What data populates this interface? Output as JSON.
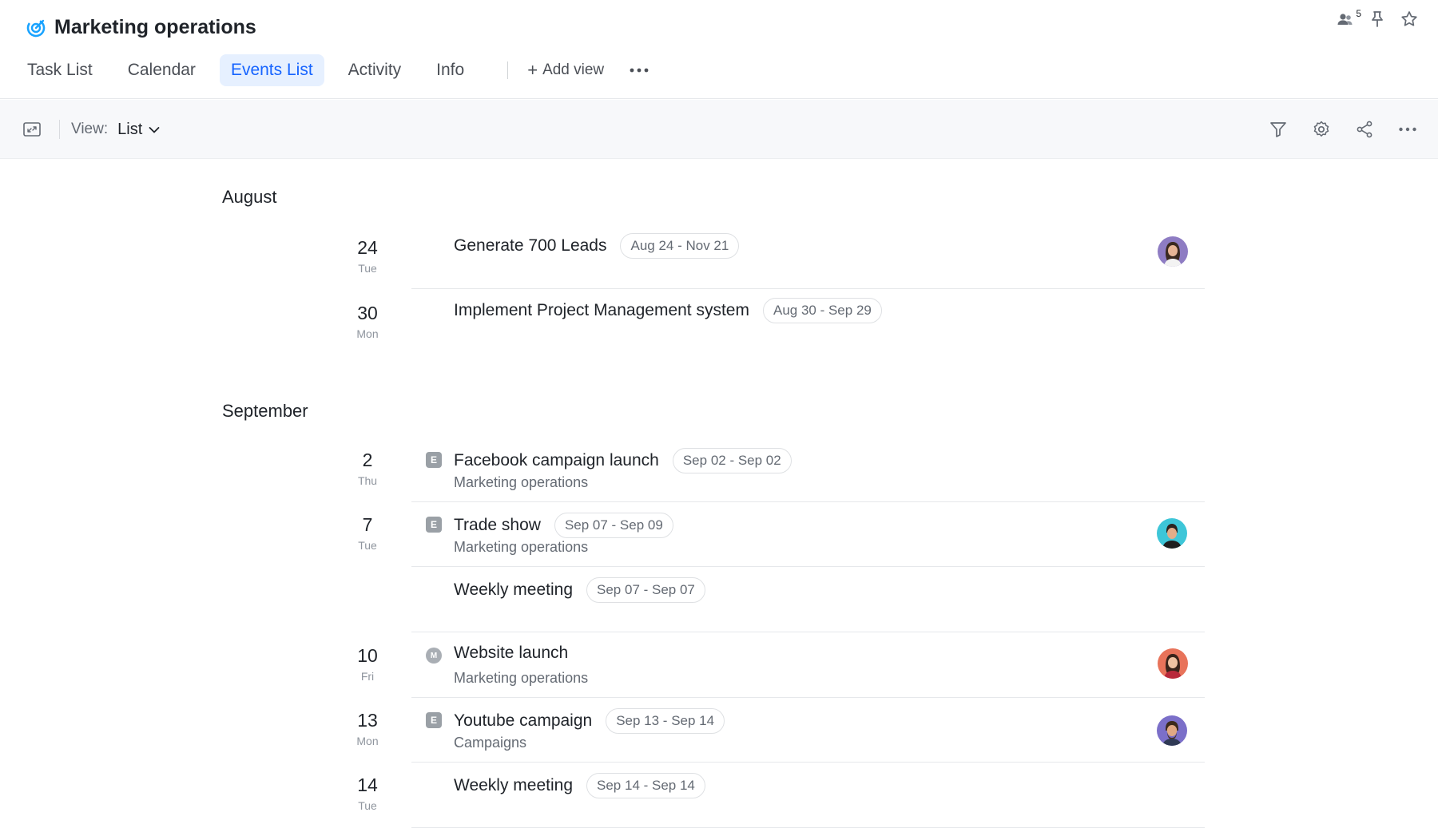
{
  "header": {
    "title": "Marketing operations",
    "members_count": "5",
    "tabs": [
      {
        "label": "Task List"
      },
      {
        "label": "Calendar"
      },
      {
        "label": "Events List"
      },
      {
        "label": "Activity"
      },
      {
        "label": "Info"
      }
    ],
    "active_tab": "Events List",
    "add_view_label": "Add view",
    "icons": [
      "target-icon",
      "members-icon",
      "pin-icon",
      "star-icon",
      "more-horizontal-icon"
    ]
  },
  "toolbar": {
    "view_label": "View:",
    "view_value": "List",
    "icons": [
      "expand-icon",
      "chevron-down-icon",
      "filter-icon",
      "settings-icon",
      "share-icon",
      "more-horizontal-icon"
    ]
  },
  "events": {
    "months": [
      {
        "label": "August"
      },
      {
        "label": "September"
      }
    ],
    "days": [
      {
        "num": "24",
        "dow": "Tue"
      },
      {
        "num": "30",
        "dow": "Mon"
      },
      {
        "num": "2",
        "dow": "Thu"
      },
      {
        "num": "7",
        "dow": "Tue"
      },
      {
        "num": "10",
        "dow": "Fri"
      },
      {
        "num": "13",
        "dow": "Mon"
      },
      {
        "num": "14",
        "dow": "Tue"
      }
    ],
    "items": [
      {
        "title": "Generate 700 Leads",
        "range": "Aug 24 - Nov 21",
        "subtitle": "",
        "type": "",
        "avatar": "avatar-woman-purple"
      },
      {
        "title": "Implement Project Management system",
        "range": "Aug 30 - Sep 29",
        "subtitle": "",
        "type": "",
        "avatar": ""
      },
      {
        "title": "Facebook campaign launch",
        "range": "Sep 02 - Sep 02",
        "subtitle": "Marketing operations",
        "type": "E",
        "avatar": ""
      },
      {
        "title": "Trade show",
        "range": "Sep 07 - Sep 09",
        "subtitle": "Marketing operations",
        "type": "E",
        "avatar": "avatar-man-teal"
      },
      {
        "title": "Weekly meeting",
        "range": "Sep 07 - Sep 07",
        "subtitle": "",
        "type": "",
        "avatar": ""
      },
      {
        "title": "Website launch",
        "range": "",
        "subtitle": "Marketing operations",
        "type": "M",
        "avatar": "avatar-woman-red"
      },
      {
        "title": "Youtube campaign",
        "range": "Sep 13 - Sep 14",
        "subtitle": "Campaigns",
        "type": "E",
        "avatar": "avatar-man-purple"
      },
      {
        "title": "Weekly meeting",
        "range": "Sep 14 - Sep 14",
        "subtitle": "",
        "type": "",
        "avatar": ""
      }
    ]
  },
  "colors": {
    "accent": "#1664ff",
    "active_tab_bg": "#e6f0ff",
    "project_icon": "#1aa3ff",
    "toolbar_bg": "#f7f8fa"
  }
}
